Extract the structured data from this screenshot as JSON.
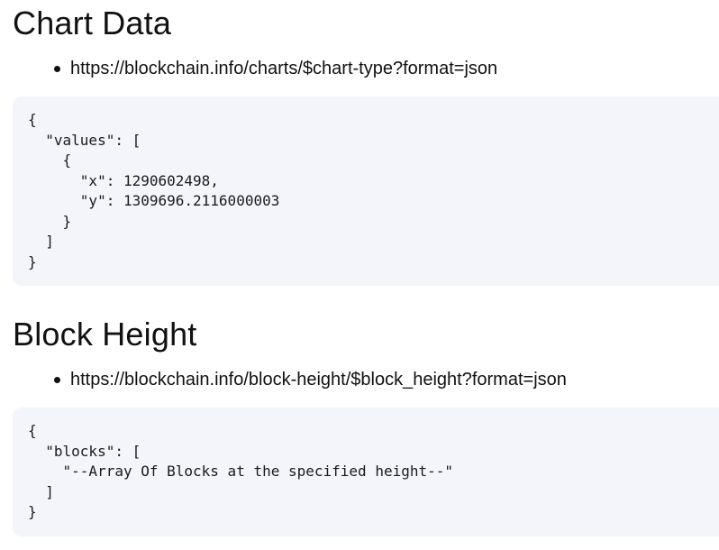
{
  "sections": [
    {
      "heading": "Chart Data",
      "url": "https://blockchain.info/charts/$chart-type?format=json",
      "code_lines": [
        "{",
        "  \"values\": [",
        "    {",
        "      \"x\": 1290602498,",
        "      \"y\": 1309696.2116000003",
        "    }",
        "  ]",
        "}"
      ]
    },
    {
      "heading": "Block Height",
      "url": "https://blockchain.info/block-height/$block_height?format=json",
      "code_lines": [
        "{",
        "  \"blocks\": [",
        "    \"--Array Of Blocks at the specified height--\"",
        "  ]",
        "}"
      ]
    }
  ]
}
